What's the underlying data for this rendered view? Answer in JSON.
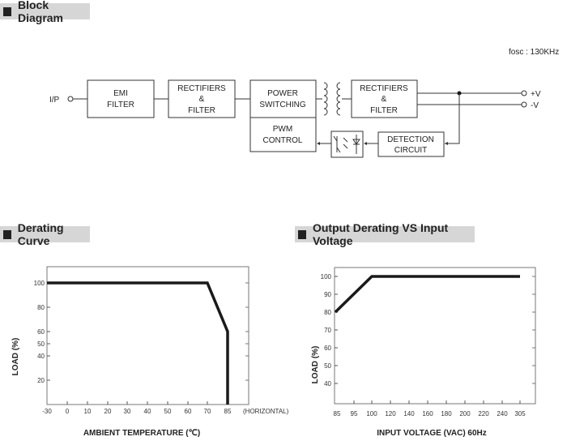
{
  "sections": {
    "block_diagram": "Block Diagram",
    "derating_curve": "Derating Curve",
    "output_derating": "Output Derating VS Input Voltage"
  },
  "block_diagram": {
    "fosc": "fosc : 130KHz",
    "input_label": "I/P",
    "out_pos": "+V",
    "out_neg": "-V",
    "blocks": {
      "emi": [
        "EMI",
        "FILTER"
      ],
      "rect1": [
        "RECTIFIERS",
        "&",
        "FILTER"
      ],
      "power": [
        "POWER",
        "SWITCHING"
      ],
      "pwm": [
        "PWM",
        "CONTROL"
      ],
      "rect2": [
        "RECTIFIERS",
        "&",
        "FILTER"
      ],
      "detection": [
        "DETECTION",
        "CIRCUIT"
      ]
    }
  },
  "chart_data": [
    {
      "type": "line",
      "title": "Derating Curve",
      "xlabel": "AMBIENT TEMPERATURE (℃)",
      "ylabel": "LOAD (%)",
      "x_note": "(HORIZONTAL)",
      "x_ticks": [
        -30,
        0,
        10,
        20,
        30,
        40,
        50,
        60,
        70,
        85
      ],
      "y_ticks": [
        20,
        40,
        50,
        60,
        80,
        100
      ],
      "xlim": [
        -30,
        95
      ],
      "ylim": [
        0,
        110
      ],
      "series": [
        {
          "name": "Load",
          "x": [
            -30,
            70,
            85,
            85
          ],
          "y": [
            100,
            100,
            60,
            0
          ]
        }
      ],
      "grid": false
    },
    {
      "type": "line",
      "title": "Output Derating VS Input Voltage",
      "xlabel": "INPUT VOLTAGE (VAC) 60Hz",
      "ylabel": "LOAD (%)",
      "x_ticks": [
        "85",
        "95",
        "100",
        "120",
        "140",
        "160",
        "180",
        "200",
        "220",
        "240",
        "305"
      ],
      "y_ticks": [
        40,
        50,
        60,
        70,
        80,
        90,
        100
      ],
      "ylim": [
        30,
        105
      ],
      "series": [
        {
          "name": "Load",
          "x": [
            "85",
            "100",
            "305"
          ],
          "y": [
            80,
            100,
            100
          ]
        }
      ],
      "grid": false
    }
  ]
}
